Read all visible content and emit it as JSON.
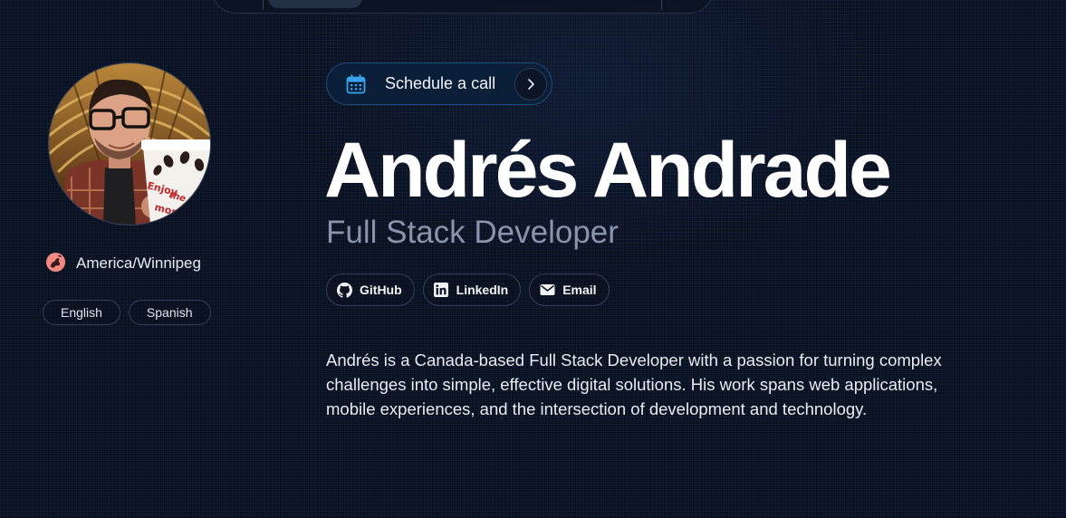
{
  "profile": {
    "name": "Andrés Andrade",
    "role": "Full Stack Developer",
    "timezone": "America/Winnipeg",
    "languages": [
      "English",
      "Spanish"
    ],
    "bio": "Andrés is a Canada-based Full Stack Developer with a passion for turning complex challenges into simple, effective digital solutions. His work spans web applications, mobile experiences, and the intersection of development and technology."
  },
  "schedule": {
    "label": "Schedule a call"
  },
  "social": [
    {
      "label": "GitHub",
      "icon": "github-icon"
    },
    {
      "label": "LinkedIn",
      "icon": "linkedin-icon"
    },
    {
      "label": "Email",
      "icon": "email-icon"
    }
  ],
  "avatar": {
    "cup_text": "Enjoy the mome"
  },
  "colors": {
    "background": "#0a1120",
    "accent": "#38a4f0",
    "muted_text": "#8a94ab",
    "pill_border": "#34405a",
    "globe": "#f08a80"
  }
}
